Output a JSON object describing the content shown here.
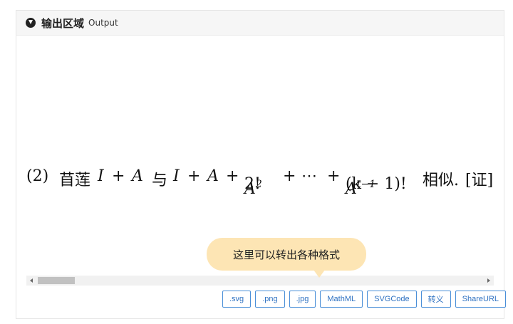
{
  "header": {
    "title": "输出区域",
    "subtitle": "Output",
    "icon": "circle-down-arrow-icon"
  },
  "math": {
    "item_number": "(2)",
    "lead_text": "苜莲",
    "expr1_I": "I",
    "plus1": "+",
    "expr1_A": "A",
    "connector": "与",
    "expr2_I": "I",
    "plus2": "+",
    "expr2_A": "A",
    "plus3": "+",
    "frac1_num_base": "A",
    "frac1_num_exp": "2",
    "frac1_den": "2!",
    "plus4": "+",
    "dots": "⋯",
    "plus5": "+",
    "frac2_num_base": "A",
    "frac2_num_exp": "t−1",
    "frac2_den": "(k − 1)!",
    "tail_text": "相似.",
    "bracket_text": "[证]"
  },
  "tooltip": {
    "text": "这里可以转出各种格式"
  },
  "buttons": [
    {
      "label": ".svg"
    },
    {
      "label": ".png"
    },
    {
      "label": ".jpg"
    },
    {
      "label": "MathML"
    },
    {
      "label": "SVGCode"
    },
    {
      "label": "转义"
    },
    {
      "label": "ShareURL"
    }
  ],
  "colors": {
    "button_border": "#4a8fd8",
    "button_text": "#2f72c2",
    "tooltip_bg": "#fde5b4",
    "header_bg": "#f6f6f6"
  }
}
